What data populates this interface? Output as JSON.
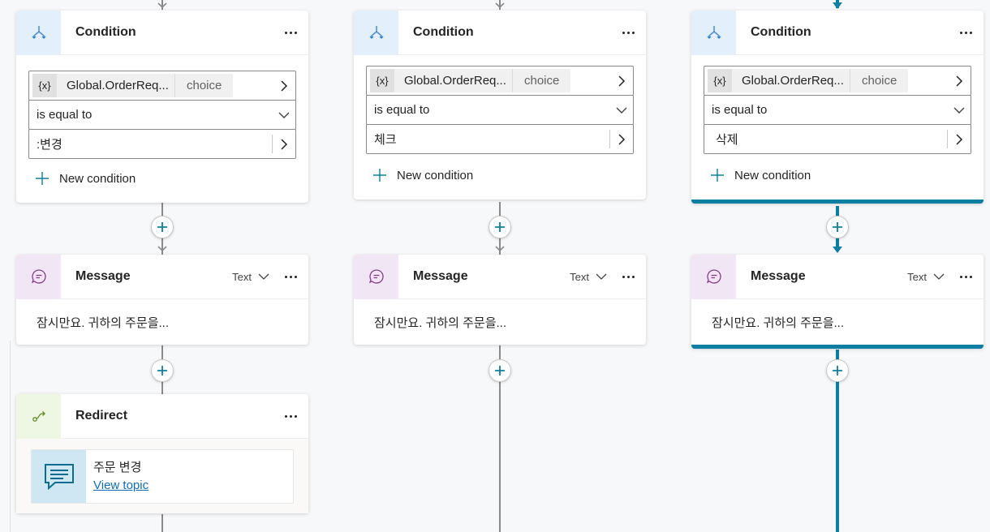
{
  "columns": [
    {
      "condition": {
        "title": "Condition",
        "variable_badge": "{x}",
        "variable": "Global.OrderReq...",
        "variable_type": "choice",
        "operator": "is equal to",
        "value": ":변경",
        "new_condition": "New condition"
      },
      "message": {
        "title": "Message",
        "format": "Text",
        "text": "잠시만요. 귀하의 주문을..."
      },
      "redirect": {
        "title": "Redirect",
        "topic_name": "주문 변경",
        "view_link": "View topic"
      }
    },
    {
      "condition": {
        "title": "Condition",
        "variable_badge": "{x}",
        "variable": "Global.OrderReq...",
        "variable_type": "choice",
        "operator": "is equal to",
        "value": "체크",
        "new_condition": "New condition"
      },
      "message": {
        "title": "Message",
        "format": "Text",
        "text": "잠시만요. 귀하의 주문을..."
      }
    },
    {
      "condition": {
        "title": "Condition",
        "variable_badge": "{x}",
        "variable": "Global.OrderReq...",
        "variable_type": "choice",
        "operator": "is equal to",
        "value": "삭제",
        "new_condition": "New condition"
      },
      "message": {
        "title": "Message",
        "format": "Text",
        "text": "잠시만요. 귀하의 주문을..."
      }
    }
  ],
  "colors": {
    "accent": "#0f7ea3",
    "connector": "#8a8a8a",
    "link": "#0f6cbd"
  },
  "icons": {
    "condition": "branch-icon",
    "message": "chat-bubble-icon",
    "redirect": "redirect-icon",
    "topic": "topic-chat-icon",
    "add": "plus-icon",
    "more": "more-options-icon"
  }
}
